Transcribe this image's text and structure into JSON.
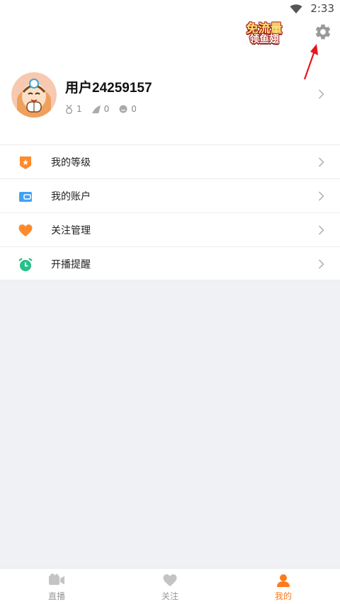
{
  "status_bar": {
    "time": "2:33"
  },
  "promo": {
    "line1": "免流量",
    "line2": "领鱼翅"
  },
  "profile": {
    "username": "用户24259157",
    "stats": [
      {
        "icon": "medal-icon",
        "value": "1"
      },
      {
        "icon": "fin-icon",
        "value": "0"
      },
      {
        "icon": "coin-icon",
        "value": "0"
      }
    ]
  },
  "menu": {
    "items": [
      {
        "label": "我的等级",
        "icon": "level-badge-icon"
      },
      {
        "label": "我的账户",
        "icon": "wallet-icon"
      },
      {
        "label": "关注管理",
        "icon": "heart-icon"
      },
      {
        "label": "开播提醒",
        "icon": "alarm-clock-icon"
      }
    ]
  },
  "tabs": [
    {
      "label": "直播",
      "icon": "video-camera-icon",
      "active": false
    },
    {
      "label": "关注",
      "icon": "heart-icon",
      "active": false
    },
    {
      "label": "我的",
      "icon": "person-icon",
      "active": true
    }
  ],
  "colors": {
    "accent": "#ff7a1a",
    "annotation_arrow": "#e8151b",
    "level_icon": "#ff8a2b",
    "wallet_icon": "#3ea2f5",
    "heart_icon": "#ff8a2b",
    "alarm_icon": "#27c08a"
  }
}
